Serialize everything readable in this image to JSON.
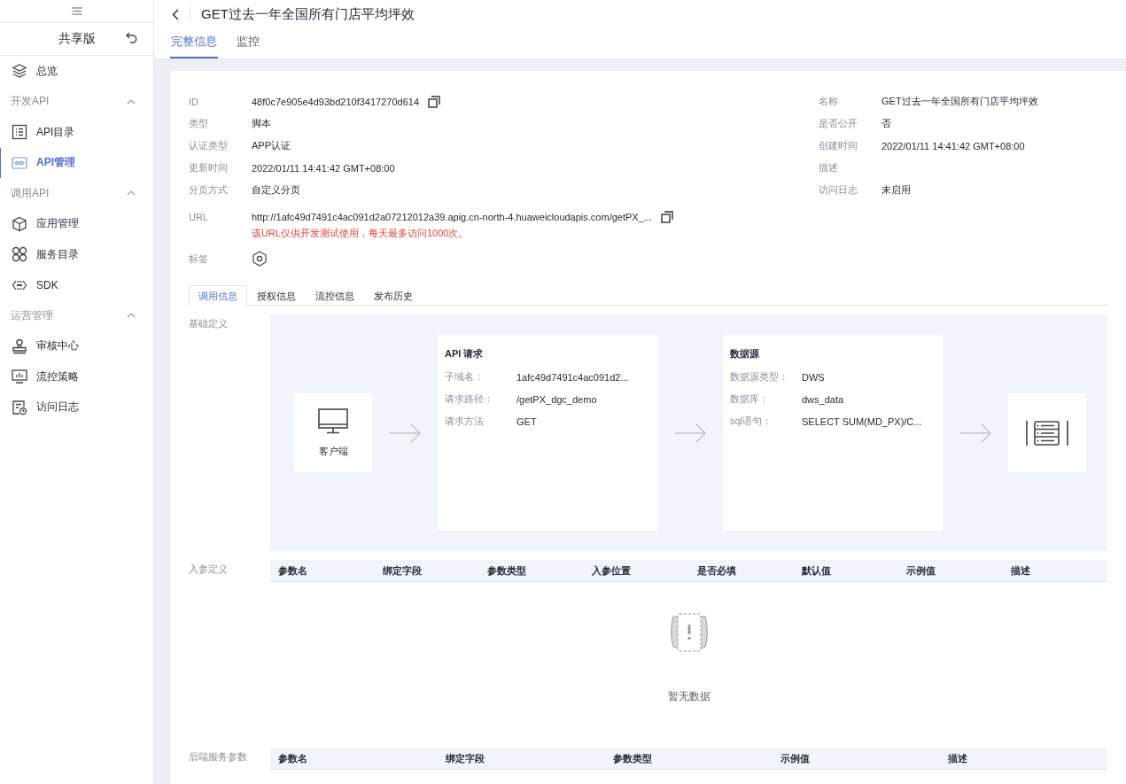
{
  "sidebar": {
    "title": "共享版",
    "items": [
      {
        "kind": "item",
        "label": "总览",
        "selected": false
      },
      {
        "kind": "group",
        "label": "开发API",
        "expanded": true,
        "children": [
          {
            "label": "API目录",
            "selected": false
          },
          {
            "label": "API管理",
            "selected": true
          }
        ]
      },
      {
        "kind": "group",
        "label": "调用API",
        "expanded": true,
        "children": [
          {
            "label": "应用管理",
            "selected": false
          },
          {
            "label": "服务目录",
            "selected": false
          },
          {
            "label": "SDK",
            "selected": false
          }
        ]
      },
      {
        "kind": "group",
        "label": "运营管理",
        "expanded": true,
        "children": [
          {
            "label": "审核中心",
            "selected": false
          },
          {
            "label": "流控策略",
            "selected": false
          },
          {
            "label": "访问日志",
            "selected": false
          }
        ]
      }
    ]
  },
  "header": {
    "title": "GET过去一年全国所有门店平均坪效",
    "tabs": [
      {
        "label": "完整信息",
        "selected": true
      },
      {
        "label": "监控",
        "selected": false
      }
    ]
  },
  "info": {
    "left": [
      {
        "kind": "copy",
        "label": "ID",
        "value": "48f0c7e905e4d93bd210f3417270d614"
      },
      {
        "kind": "text",
        "label": "类型",
        "value": "脚本"
      },
      {
        "kind": "text",
        "label": "认证类型",
        "value": "APP认证"
      },
      {
        "kind": "text",
        "label": "更新时间",
        "value": "2022/01/11 14:41:42 GMT+08:00"
      },
      {
        "kind": "text",
        "label": "分页方式",
        "value": "自定义分页"
      }
    ],
    "right": [
      {
        "label": "名称",
        "value": "GET过去一年全国所有门店平均坪效"
      },
      {
        "label": "是否公开",
        "value": "否"
      },
      {
        "label": "创建时间",
        "value": "2022/01/11 14:41:42 GMT+08:00"
      },
      {
        "label": "描述"
      },
      {
        "label": "访问日志",
        "value": "未启用"
      }
    ],
    "url": {
      "label": "URL",
      "value": "http://1afc49d7491c4ac091d2a07212012a39.apig.cn-north-4.huaweicloudapis.com/getPX_...",
      "warning": "该URL仅供开发测试使用，每天最多访问1000次。"
    },
    "tags": {
      "label": "标签"
    }
  },
  "subtabs": [
    {
      "label": "调用信息",
      "selected": true
    },
    {
      "label": "授权信息",
      "selected": false
    },
    {
      "label": "流控信息",
      "selected": false
    },
    {
      "label": "发布历史",
      "selected": false
    }
  ],
  "basic_definition": {
    "label": "基础定义",
    "client": "客户端",
    "request": {
      "title": "API 请求",
      "rows": [
        {
          "label": "子域名：",
          "value": "1afc49d7491c4ac091d2..."
        },
        {
          "label": "请求路径：",
          "value": "/getPX_dgc_demo"
        },
        {
          "label": "请求方法",
          "value": "GET"
        }
      ]
    },
    "datasource": {
      "title": "数据源",
      "rows": [
        {
          "label": "数据源类型：",
          "value": "DWS"
        },
        {
          "label": "数据库：",
          "value": "dws_data"
        },
        {
          "label": "sql语句：",
          "value": "SELECT SUM(MD_PX)/C..."
        }
      ]
    }
  },
  "input_params": {
    "label": "入参定义",
    "columns": [
      "参数名",
      "绑定字段",
      "参数类型",
      "入参位置",
      "是否必填",
      "默认值",
      "示例值",
      "描述"
    ],
    "empty_text": "暂无数据"
  },
  "backend_params": {
    "label": "后端服务参数",
    "columns": [
      "参数名",
      "绑定字段",
      "参数类型",
      "示例值",
      "描述"
    ]
  }
}
